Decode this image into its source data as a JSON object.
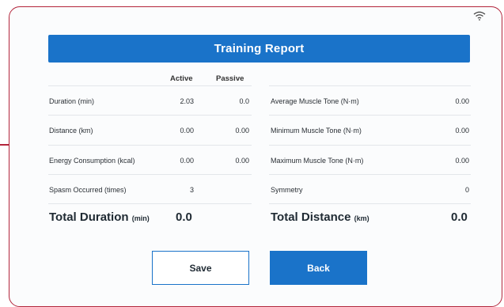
{
  "report": {
    "title": "Training Report",
    "columns": {
      "active": "Active",
      "passive": "Passive"
    },
    "left_rows": [
      {
        "label": "Duration (min)",
        "active": "2.03",
        "passive": "0.0"
      },
      {
        "label": "Distance (km)",
        "active": "0.00",
        "passive": "0.00"
      },
      {
        "label": "Energy Consumption (kcal)",
        "active": "0.00",
        "passive": "0.00"
      },
      {
        "label": "Spasm Occurred (times)",
        "active": "3",
        "passive": ""
      }
    ],
    "right_rows": [
      {
        "label": "Average Muscle Tone (N·m)",
        "value": "0.00"
      },
      {
        "label": "Minimum Muscle Tone (N·m)",
        "value": "0.00"
      },
      {
        "label": "Maximum Muscle Tone (N·m)",
        "value": "0.00"
      },
      {
        "label": "Symmetry",
        "value": "0"
      }
    ],
    "totals": {
      "duration_label": "Total Duration",
      "duration_unit": "(min)",
      "duration_value": "0.0",
      "distance_label": "Total Distance",
      "distance_unit": "(km)",
      "distance_value": "0.0"
    }
  },
  "buttons": {
    "save": "Save",
    "back": "Back"
  },
  "status": {
    "wifi_icon": "wifi-icon"
  },
  "colors": {
    "accent": "#1a73c9",
    "frame": "#b3253b"
  }
}
